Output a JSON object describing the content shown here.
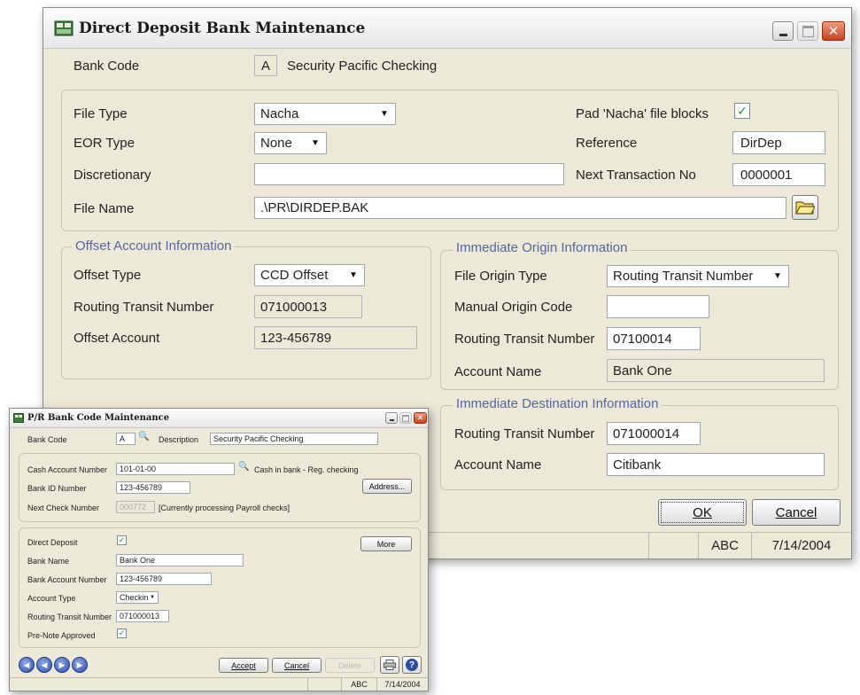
{
  "main": {
    "title": "Direct Deposit Bank Maintenance",
    "bank_code_label": "Bank Code",
    "bank_code": "A",
    "bank_name": "Security Pacific Checking",
    "file_type_label": "File Type",
    "file_type": "Nacha",
    "eor_type_label": "EOR Type",
    "eor_type": "None",
    "discretionary_label": "Discretionary",
    "discretionary": "",
    "file_name_label": "File Name",
    "file_name": ".\\PR\\DIRDEP.BAK",
    "pad_label": "Pad 'Nacha' file blocks",
    "pad_checked": true,
    "reference_label": "Reference",
    "reference": "DirDep",
    "next_txn_label": "Next Transaction No",
    "next_txn": "0000001",
    "offset_group": {
      "title": "Offset Account Information",
      "offset_type_label": "Offset Type",
      "offset_type": "CCD Offset",
      "rtn_label": "Routing Transit Number",
      "rtn": "071000013",
      "offset_account_label": "Offset Account",
      "offset_account": "123-456789"
    },
    "origin_group": {
      "title": "Immediate Origin Information",
      "file_origin_type_label": "File Origin Type",
      "file_origin_type": "Routing Transit Number",
      "manual_origin_label": "Manual Origin Code",
      "manual_origin": "",
      "rtn_label": "Routing Transit Number",
      "rtn": "07100014",
      "account_name_label": "Account Name",
      "account_name": "Bank One"
    },
    "dest_group": {
      "title": "Immediate Destination Information",
      "rtn_label": "Routing Transit Number",
      "rtn": "071000014",
      "account_name_label": "Account Name",
      "account_name": "Citibank"
    },
    "ok_label": "OK",
    "cancel_label": "Cancel",
    "status": {
      "company": "ABC",
      "date": "7/14/2004"
    }
  },
  "small": {
    "title": "P/R Bank Code Maintenance",
    "bank_code_label": "Bank Code",
    "bank_code": "A",
    "description_label": "Description",
    "description": "Security Pacific Checking",
    "cash_account_label": "Cash Account Number",
    "cash_account": "101-01-00",
    "cash_account_desc": "Cash in bank - Reg. checking",
    "bank_id_label": "Bank ID Number",
    "bank_id": "123-456789",
    "address_label": "Address...",
    "next_check_label": "Next Check Number",
    "next_check": "000772",
    "next_check_note": "[Currently processing Payroll checks]",
    "direct_deposit_label": "Direct Deposit",
    "direct_deposit_checked": true,
    "more_label": "More",
    "bank_name_label": "Bank Name",
    "bank_name": "Bank One",
    "bank_account_label": "Bank Account Number",
    "bank_account": "123-456789",
    "account_type_label": "Account Type",
    "account_type": "Checking",
    "rtn_label": "Routing Transit Number",
    "rtn": "071000013",
    "prenote_label": "Pre-Note Approved",
    "prenote_checked": true,
    "accept_label": "Accept",
    "cancel_label": "Cancel",
    "delete_label": "Delete",
    "status": {
      "company": "ABC",
      "date": "7/14/2004"
    }
  }
}
